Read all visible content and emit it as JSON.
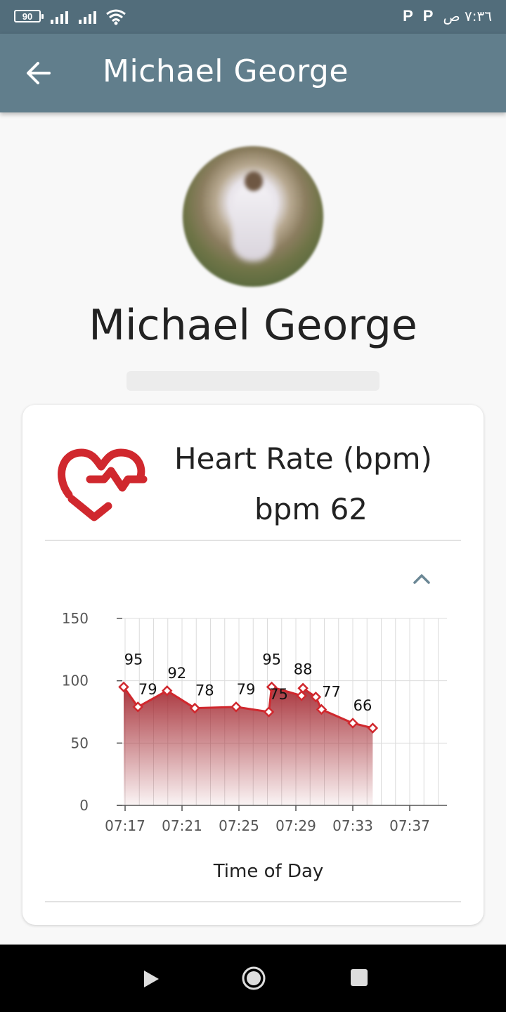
{
  "status_bar": {
    "battery": "90",
    "right_icons": [
      "P",
      "P"
    ],
    "time": "٧:٣٦ ص"
  },
  "app_bar": {
    "title": "Michael George",
    "back_icon": "arrow-back-icon"
  },
  "profile": {
    "name": "Michael George"
  },
  "card": {
    "icon": "heart-rate-icon",
    "title": "Heart Rate (bpm)",
    "value": "bpm 62",
    "collapse_icon": "chevron-up-icon",
    "accent_color": "#d0282e"
  },
  "chart_data": {
    "type": "area",
    "xlabel": "Time of Day",
    "ylabel": "",
    "ylim": [
      0,
      150
    ],
    "yticks": [
      0,
      50,
      100,
      150
    ],
    "xticks": [
      "07:17",
      "07:21",
      "07:25",
      "07:29",
      "07:33",
      "07:37"
    ],
    "grid": true,
    "series": [
      {
        "points": [
          {
            "t": "07:16:54",
            "y": 95,
            "label": "95"
          },
          {
            "t": "07:17:54",
            "y": 79,
            "label": "79"
          },
          {
            "t": "07:19:57",
            "y": 92,
            "label": "92"
          },
          {
            "t": "07:21:54",
            "y": 78,
            "label": "78"
          },
          {
            "t": "07:24:48",
            "y": 79,
            "label": "79"
          },
          {
            "t": "07:27:06",
            "y": 75,
            "label": "75"
          },
          {
            "t": "07:27:18",
            "y": 95,
            "label": "95"
          },
          {
            "t": "07:29:24",
            "y": 88,
            "label": ""
          },
          {
            "t": "07:29:30",
            "y": 94,
            "label": "88"
          },
          {
            "t": "07:30:24",
            "y": 87,
            "label": ""
          },
          {
            "t": "07:30:48",
            "y": 77,
            "label": "77"
          },
          {
            "t": "07:33:00",
            "y": 66,
            "label": "66"
          },
          {
            "t": "07:34:24",
            "y": 62,
            "label": ""
          }
        ]
      }
    ]
  },
  "nav": {
    "back": "back-triangle-icon",
    "home": "home-circle-icon",
    "recents": "recents-square-icon"
  }
}
